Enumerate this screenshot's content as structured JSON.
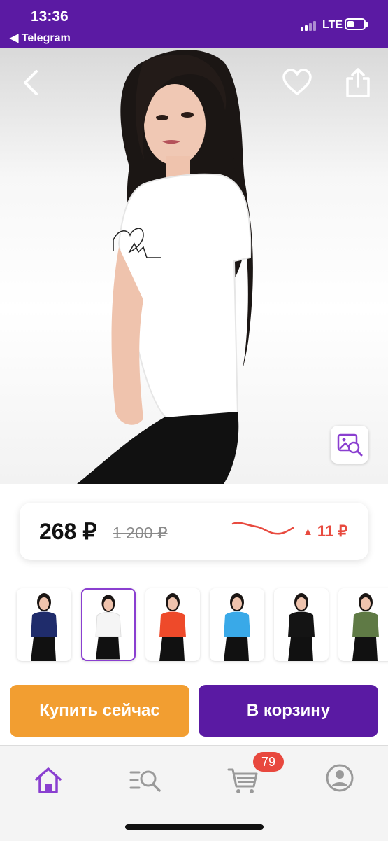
{
  "status_bar": {
    "time": "13:36",
    "back_app": "◀ Telegram",
    "network": "LTE"
  },
  "product": {
    "image_alt": "Woman in white t-shirt with heartbeat print",
    "price": "268 ₽",
    "old_price": "1 200 ₽",
    "price_change": "11 ₽",
    "price_change_direction": "up",
    "trend_color": "#e84a3f"
  },
  "thumbnails": [
    {
      "color": "#1f2c6b",
      "selected": false
    },
    {
      "color": "#ffffff",
      "selected": true
    },
    {
      "color": "#ee4a2a",
      "selected": false
    },
    {
      "color": "#39a9e8",
      "selected": false
    },
    {
      "color": "#141414",
      "selected": false
    },
    {
      "color": "#5f7a45",
      "selected": false
    }
  ],
  "actions": {
    "buy_now": "Купить сейчас",
    "add_to_cart": "В корзину"
  },
  "tabbar": {
    "cart_badge": "79",
    "tabs": [
      "home-icon",
      "catalog-search-icon",
      "cart-icon",
      "profile-icon"
    ]
  },
  "colors": {
    "brand_purple": "#5b1aa3",
    "buy_orange": "#f29e31",
    "accent_red": "#e84a3f"
  }
}
